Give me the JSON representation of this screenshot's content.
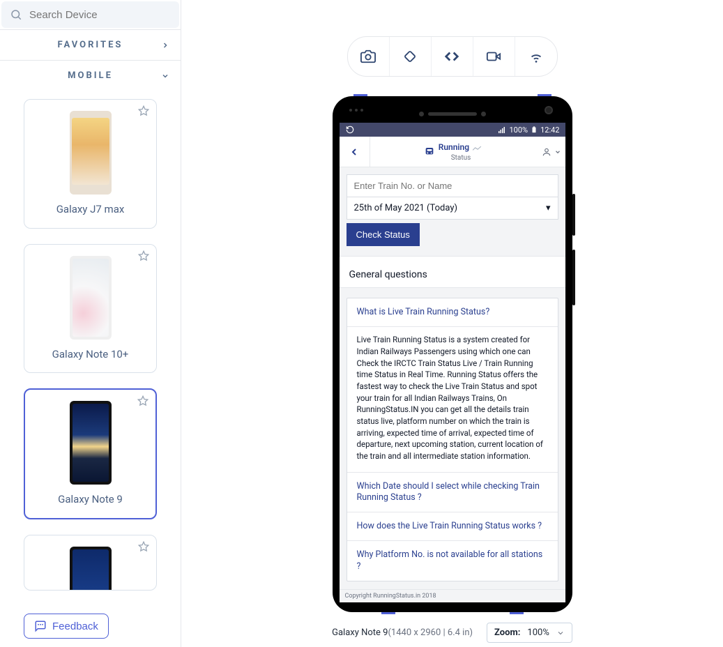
{
  "sidebar": {
    "search_placeholder": "Search Device",
    "favorites_label": "FAVORITES",
    "mobile_label": "MOBILE",
    "feedback_label": "Feedback",
    "devices": [
      {
        "label": "Galaxy J7 max"
      },
      {
        "label": "Galaxy Note 10+"
      },
      {
        "label": "Galaxy Note 9"
      },
      {
        "label": ""
      }
    ]
  },
  "phone": {
    "status": {
      "network": "100%",
      "time": "12:42"
    },
    "header": {
      "logo_top": "Running",
      "logo_bottom": "Status"
    },
    "form": {
      "train_placeholder": "Enter Train No. or Name",
      "date_value": "25th of May 2021 (Today)",
      "button": "Check Status"
    },
    "section_title": "General questions",
    "faq": {
      "q1": "What is Live Train Running Status?",
      "a1": "Live Train Running Status is a system created for Indian Railways Passengers using which one can Check the IRCTC Train Status Live / Train Running time Status in Real Time. Running Status offers the fastest way to check the Live Train Status and spot your train for all Indian Railways Trains, On RunningStatus.IN you can get all the details train status live, platform number on which the train is arriving, expected time of arrival, expected time of departure, next upcoming station, current location of the train and all intermediate station information.",
      "q2": "Which Date should I select while checking Train Running Status ?",
      "q3": "How does the Live Train Running Status works ?",
      "q4": "Why Platform No. is not available for all stations ?"
    },
    "footer": "Copyright RunningStatus.in 2018"
  },
  "bottombar": {
    "device_name": "Galaxy Note 9",
    "device_dims": "(1440 x 2960 | 6.4 in)",
    "zoom_label": "Zoom:",
    "zoom_value": "100%"
  }
}
